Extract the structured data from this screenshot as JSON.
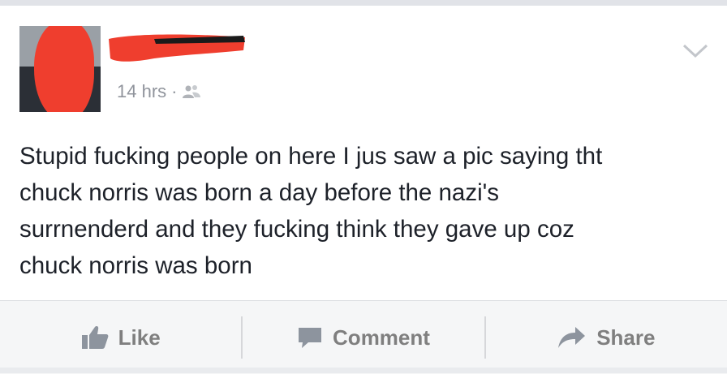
{
  "post": {
    "timestamp": "14 hrs",
    "separator": "·",
    "audience_icon": "friends-icon",
    "menu_icon": "chevron-down-icon",
    "lines": [
      "Stupid fucking people on here I jus saw a pic saying tht",
      "chuck norris was born a day before the nazi's",
      "surrnenderd and they fucking think they gave up coz",
      "chuck norris was born"
    ]
  },
  "actions": {
    "like_label": "Like",
    "comment_label": "Comment",
    "share_label": "Share"
  },
  "colors": {
    "text": "#1d2129",
    "meta": "#90949c",
    "action": "#7f7f7f",
    "redaction": "#ef3e2e"
  }
}
